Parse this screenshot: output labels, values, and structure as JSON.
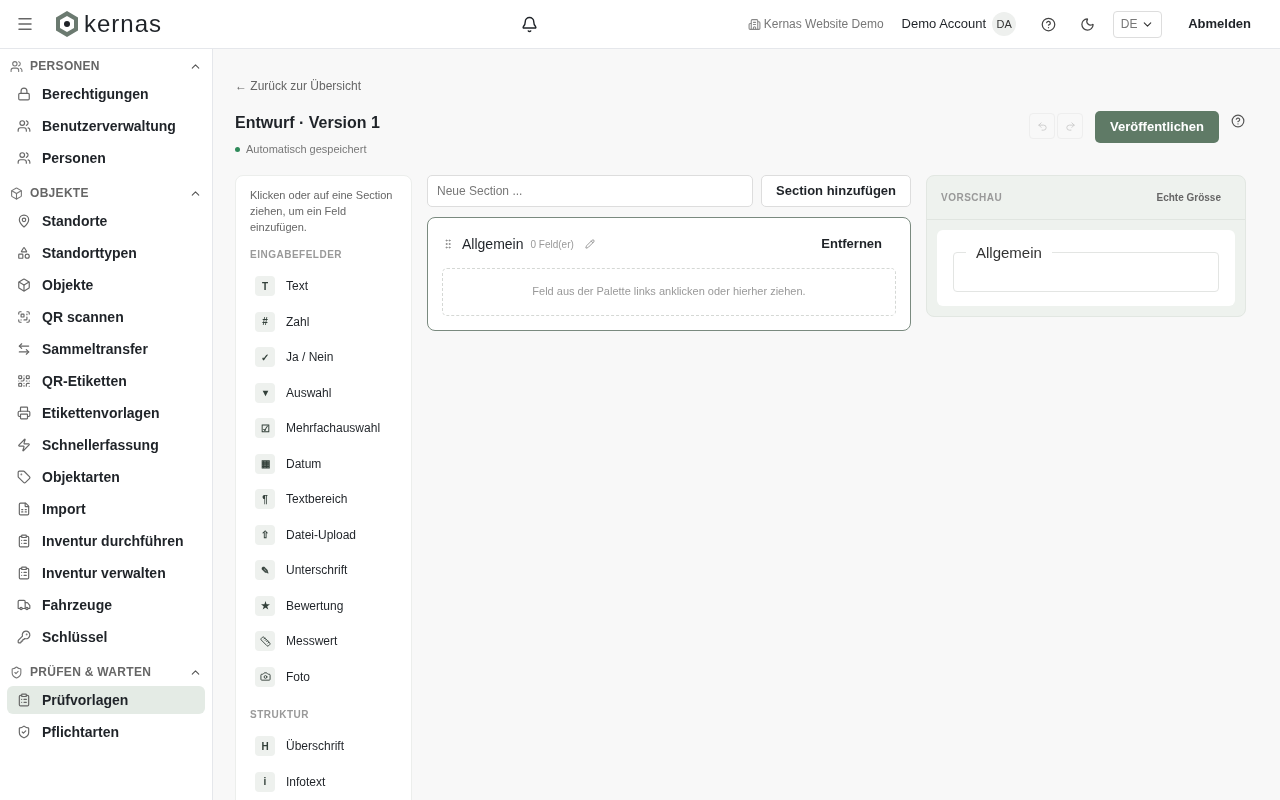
{
  "header": {
    "logo": "kernas",
    "tenant": "Kernas Website Demo",
    "account": "Demo Account",
    "avatar": "DA",
    "language": "DE",
    "logout": "Abmelden"
  },
  "sidebar": {
    "sections": [
      {
        "title": "PERSONEN",
        "expanded": true,
        "items": [
          {
            "label": "Berechtigungen",
            "selected": false
          },
          {
            "label": "Benutzerverwaltung",
            "selected": false
          },
          {
            "label": "Personen",
            "selected": false
          }
        ]
      },
      {
        "title": "OBJEKTE",
        "expanded": true,
        "items": [
          {
            "label": "Standorte",
            "selected": false
          },
          {
            "label": "Standorttypen",
            "selected": false
          },
          {
            "label": "Objekte",
            "selected": false
          },
          {
            "label": "QR scannen",
            "selected": false
          },
          {
            "label": "Sammeltransfer",
            "selected": false
          },
          {
            "label": "QR-Etiketten",
            "selected": false
          },
          {
            "label": "Etikettenvorlagen",
            "selected": false
          },
          {
            "label": "Schnellerfassung",
            "selected": false
          },
          {
            "label": "Objektarten",
            "selected": false
          },
          {
            "label": "Import",
            "selected": false
          },
          {
            "label": "Inventur durchführen",
            "selected": false
          },
          {
            "label": "Inventur verwalten",
            "selected": false
          },
          {
            "label": "Fahrzeuge",
            "selected": false
          },
          {
            "label": "Schlüssel",
            "selected": false
          }
        ]
      },
      {
        "title": "PRÜFEN & WARTEN",
        "expanded": true,
        "items": [
          {
            "label": "Prüfvorlagen",
            "selected": true
          },
          {
            "label": "Pflichtarten",
            "selected": false
          }
        ]
      }
    ]
  },
  "page": {
    "back_link": "← Zurück zur Übersicht",
    "title": "Entwurf · Version 1",
    "save_status": "Automatisch gespeichert",
    "undo": {
      "disabled": true
    },
    "redo": {
      "disabled": true
    },
    "publish_button": "Veröffentlichen"
  },
  "palette": {
    "hint": "Klicken oder auf eine Section ziehen, um ein Feld einzufügen.",
    "groups": [
      {
        "title": "EINGABEFELDER",
        "items": [
          {
            "kind": "glyph",
            "glyph": "T",
            "label": "Text"
          },
          {
            "kind": "glyph",
            "glyph": "#",
            "label": "Zahl"
          },
          {
            "kind": "glyph",
            "glyph": "✓",
            "label": "Ja / Nein"
          },
          {
            "kind": "glyph",
            "glyph": "▾",
            "label": "Auswahl"
          },
          {
            "kind": "glyph",
            "glyph": "☑",
            "label": "Mehrfachauswahl"
          },
          {
            "kind": "glyph",
            "glyph": "▦",
            "label": "Datum"
          },
          {
            "kind": "glyph",
            "glyph": "¶",
            "label": "Textbereich"
          },
          {
            "kind": "glyph",
            "glyph": "⇧",
            "label": "Datei-Upload"
          },
          {
            "kind": "glyph",
            "glyph": "✎",
            "label": "Unterschrift"
          },
          {
            "kind": "glyph",
            "glyph": "★",
            "label": "Bewertung"
          },
          {
            "kind": "ruler",
            "label": "Messwert"
          },
          {
            "kind": "camera",
            "label": "Foto"
          }
        ]
      },
      {
        "title": "STRUKTUR",
        "items": [
          {
            "kind": "glyph",
            "glyph": "H",
            "label": "Überschrift"
          },
          {
            "kind": "glyph",
            "glyph": "i",
            "label": "Infotext"
          }
        ]
      }
    ]
  },
  "builder": {
    "section_input": {
      "placeholder": "Neue Section ..."
    },
    "add_button": "Section hinzufügen",
    "sections": [
      {
        "name": "Allgemein",
        "count": "0 Feld(er)",
        "remove": "Entfernen",
        "dropzone": "Feld aus der Palette links anklicken oder hierher ziehen."
      }
    ]
  },
  "preview": {
    "title": "VORSCHAU",
    "size_button": "Echte Grösse",
    "sections": [
      {
        "legend": "Allgemein"
      }
    ]
  }
}
